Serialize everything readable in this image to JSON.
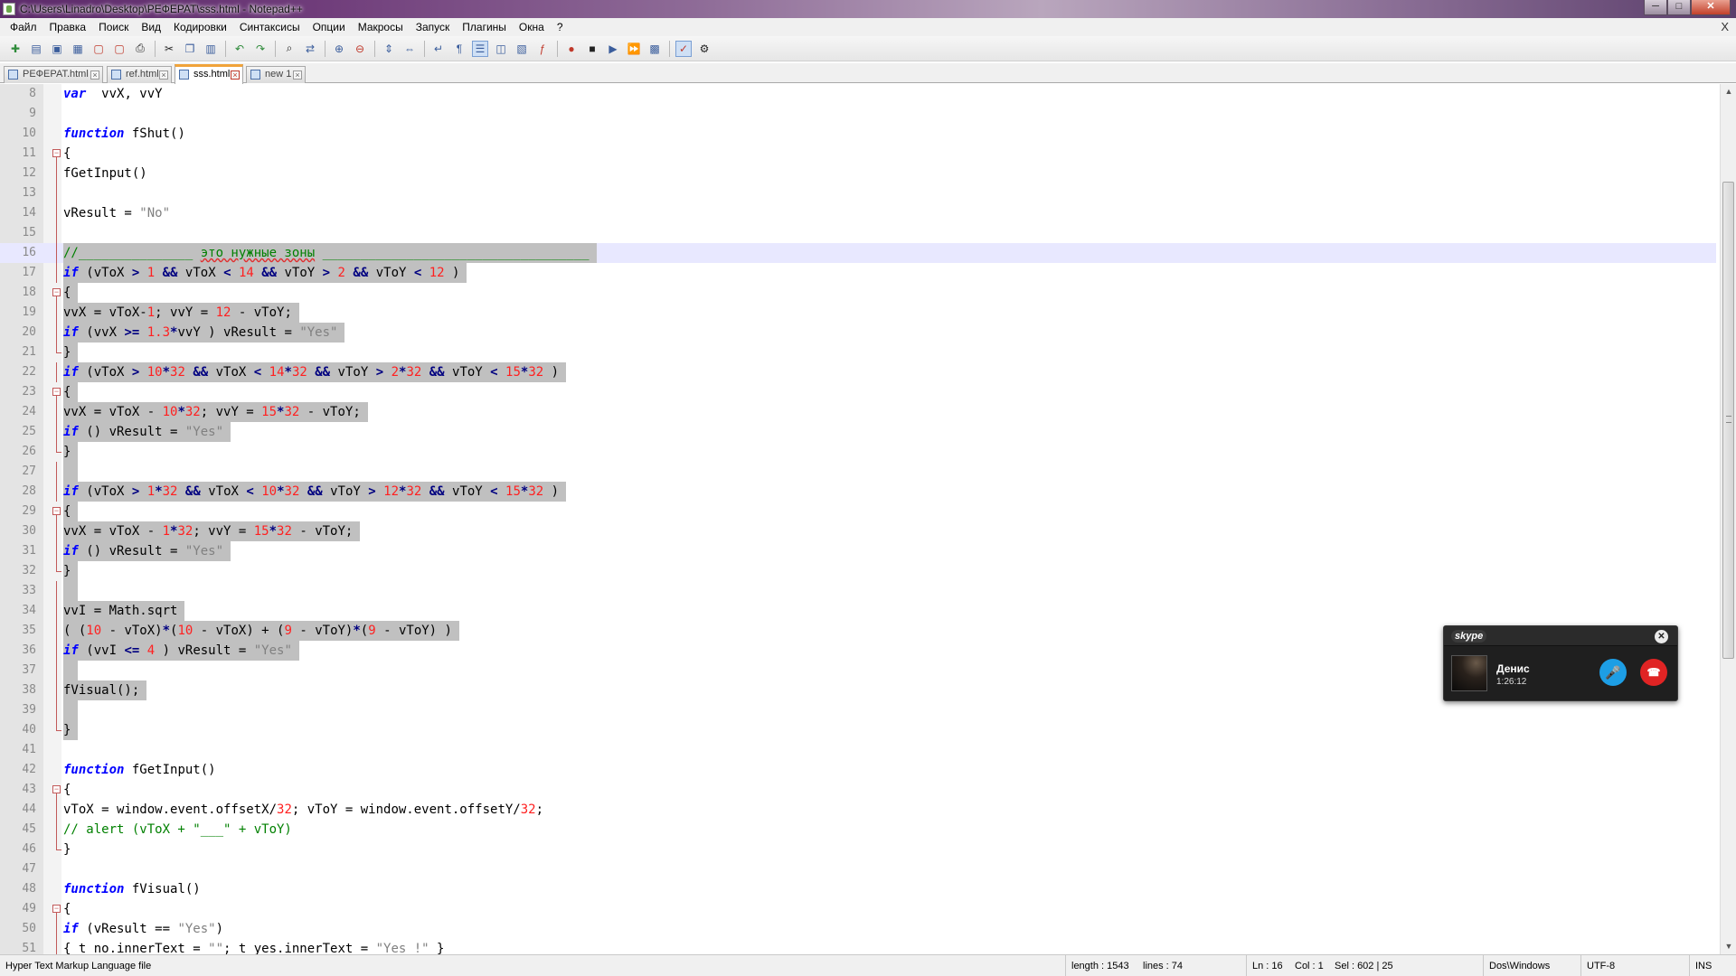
{
  "window": {
    "title": "C:\\Users\\Linadro\\Desktop\\РЕФЕРАТ\\sss.html - Notepad++",
    "minimize_glyph": "─",
    "maximize_glyph": "□",
    "close_glyph": "✕"
  },
  "menu": {
    "items": [
      "Файл",
      "Правка",
      "Поиск",
      "Вид",
      "Кодировки",
      "Синтаксисы",
      "Опции",
      "Макросы",
      "Запуск",
      "Плагины",
      "Окна",
      "?"
    ],
    "close_doc_glyph": "X"
  },
  "toolbar": {
    "icons": [
      "new-file-icon",
      "open-file-icon",
      "save-icon",
      "save-all-icon",
      "close-icon",
      "close-all-icon",
      "print-icon",
      "cut-icon",
      "copy-icon",
      "paste-icon",
      "undo-icon",
      "redo-icon",
      "find-icon",
      "replace-icon",
      "zoom-in-icon",
      "zoom-out-icon",
      "sync-vertical-icon",
      "sync-horizontal-icon",
      "word-wrap-icon",
      "show-all-chars-icon",
      "indent-guide-icon",
      "user-language-icon",
      "document-map-icon",
      "function-list-icon",
      "record-macro-icon",
      "stop-record-icon",
      "play-macro-icon",
      "run-macro-multiple-icon",
      "save-macro-icon",
      "spell-check-icon",
      "spell-settings-icon"
    ]
  },
  "tabs": [
    {
      "label": "РЕФЕРАТ.html",
      "active": false
    },
    {
      "label": "ref.html",
      "active": false
    },
    {
      "label": "sss.html",
      "active": true
    },
    {
      "label": "new  1",
      "active": false
    }
  ],
  "editor": {
    "colors": {
      "keyword": "#0000ff",
      "number": "#ff2020",
      "string": "#808080",
      "comment": "#008000",
      "selection": "#c0c0c0",
      "current_line": "#e8e8ff"
    },
    "lines": [
      {
        "n": "8",
        "fold": "",
        "sel": false,
        "tokens": [
          [
            "kw",
            "var"
          ],
          [
            "",
            "  vvX, vvY"
          ]
        ]
      },
      {
        "n": "9",
        "fold": "",
        "sel": false,
        "tokens": []
      },
      {
        "n": "10",
        "fold": "",
        "sel": false,
        "tokens": [
          [
            "kw",
            "function"
          ],
          [
            "",
            " fShut()"
          ]
        ]
      },
      {
        "n": "11",
        "fold": "box",
        "sel": false,
        "tokens": [
          [
            "",
            "{"
          ]
        ]
      },
      {
        "n": "12",
        "fold": "line",
        "sel": false,
        "tokens": [
          [
            "",
            "fGetInput()"
          ]
        ]
      },
      {
        "n": "13",
        "fold": "line",
        "sel": false,
        "tokens": []
      },
      {
        "n": "14",
        "fold": "line",
        "sel": false,
        "tokens": [
          [
            "",
            "vResult = "
          ],
          [
            "str",
            "\"No\""
          ]
        ]
      },
      {
        "n": "15",
        "fold": "line",
        "sel": false,
        "tokens": []
      },
      {
        "n": "16",
        "fold": "line",
        "sel": true,
        "current": true,
        "tokens": [
          [
            "cmt",
            "//_______________ "
          ],
          [
            "cmt squig",
            "это нужные зоны"
          ],
          [
            "cmt",
            " ___________________________________"
          ]
        ]
      },
      {
        "n": "17",
        "fold": "line",
        "sel": true,
        "tokens": [
          [
            "kw",
            "if"
          ],
          [
            "",
            " (vToX "
          ],
          [
            "op",
            ">"
          ],
          [
            "",
            " "
          ],
          [
            "num",
            "1"
          ],
          [
            "",
            " "
          ],
          [
            "op",
            "&&"
          ],
          [
            "",
            " vToX "
          ],
          [
            "op",
            "<"
          ],
          [
            "",
            " "
          ],
          [
            "num",
            "14"
          ],
          [
            "",
            " "
          ],
          [
            "op",
            "&&"
          ],
          [
            "",
            " vToY "
          ],
          [
            "op",
            ">"
          ],
          [
            "",
            " "
          ],
          [
            "num",
            "2"
          ],
          [
            "",
            " "
          ],
          [
            "op",
            "&&"
          ],
          [
            "",
            " vToY "
          ],
          [
            "op",
            "<"
          ],
          [
            "",
            " "
          ],
          [
            "num",
            "12"
          ],
          [
            "",
            " )"
          ]
        ]
      },
      {
        "n": "18",
        "fold": "box",
        "sel": true,
        "tokens": [
          [
            "",
            "{"
          ]
        ]
      },
      {
        "n": "19",
        "fold": "line",
        "sel": true,
        "tokens": [
          [
            "",
            "vvX = vToX-"
          ],
          [
            "num",
            "1"
          ],
          [
            "",
            "; vvY = "
          ],
          [
            "num",
            "12"
          ],
          [
            "",
            " - vToY;"
          ]
        ]
      },
      {
        "n": "20",
        "fold": "line",
        "sel": true,
        "tokens": [
          [
            "kw",
            "if"
          ],
          [
            "",
            " (vvX "
          ],
          [
            "op",
            ">="
          ],
          [
            "",
            " "
          ],
          [
            "num",
            "1.3"
          ],
          [
            "op",
            "*"
          ],
          [
            "",
            "vvY ) vResult = "
          ],
          [
            "str",
            "\"Yes\""
          ]
        ]
      },
      {
        "n": "21",
        "fold": "end",
        "sel": true,
        "tokens": [
          [
            "",
            "}"
          ]
        ]
      },
      {
        "n": "22",
        "fold": "line",
        "sel": true,
        "tokens": [
          [
            "kw",
            "if"
          ],
          [
            "",
            " (vToX "
          ],
          [
            "op",
            ">"
          ],
          [
            "",
            " "
          ],
          [
            "num",
            "10"
          ],
          [
            "op",
            "*"
          ],
          [
            "num",
            "32"
          ],
          [
            "",
            " "
          ],
          [
            "op",
            "&&"
          ],
          [
            "",
            " vToX "
          ],
          [
            "op",
            "<"
          ],
          [
            "",
            " "
          ],
          [
            "num",
            "14"
          ],
          [
            "op",
            "*"
          ],
          [
            "num",
            "32"
          ],
          [
            "",
            " "
          ],
          [
            "op",
            "&&"
          ],
          [
            "",
            " vToY "
          ],
          [
            "op",
            ">"
          ],
          [
            "",
            " "
          ],
          [
            "num",
            "2"
          ],
          [
            "op",
            "*"
          ],
          [
            "num",
            "32"
          ],
          [
            "",
            " "
          ],
          [
            "op",
            "&&"
          ],
          [
            "",
            " vToY "
          ],
          [
            "op",
            "<"
          ],
          [
            "",
            " "
          ],
          [
            "num",
            "15"
          ],
          [
            "op",
            "*"
          ],
          [
            "num",
            "32"
          ],
          [
            "",
            " )"
          ]
        ]
      },
      {
        "n": "23",
        "fold": "box",
        "sel": true,
        "tokens": [
          [
            "",
            "{"
          ]
        ]
      },
      {
        "n": "24",
        "fold": "line",
        "sel": true,
        "tokens": [
          [
            "",
            "vvX = vToX - "
          ],
          [
            "num",
            "10"
          ],
          [
            "op",
            "*"
          ],
          [
            "num",
            "32"
          ],
          [
            "",
            "; vvY = "
          ],
          [
            "num",
            "15"
          ],
          [
            "op",
            "*"
          ],
          [
            "num",
            "32"
          ],
          [
            "",
            " - vToY;"
          ]
        ]
      },
      {
        "n": "25",
        "fold": "line",
        "sel": true,
        "tokens": [
          [
            "kw",
            "if"
          ],
          [
            "",
            " () vResult = "
          ],
          [
            "str",
            "\"Yes\""
          ]
        ]
      },
      {
        "n": "26",
        "fold": "end",
        "sel": true,
        "tokens": [
          [
            "",
            "}"
          ]
        ]
      },
      {
        "n": "27",
        "fold": "line",
        "sel": true,
        "tokens": []
      },
      {
        "n": "28",
        "fold": "line",
        "sel": true,
        "tokens": [
          [
            "kw",
            "if"
          ],
          [
            "",
            " (vToX "
          ],
          [
            "op",
            ">"
          ],
          [
            "",
            " "
          ],
          [
            "num",
            "1"
          ],
          [
            "op",
            "*"
          ],
          [
            "num",
            "32"
          ],
          [
            "",
            " "
          ],
          [
            "op",
            "&&"
          ],
          [
            "",
            " vToX "
          ],
          [
            "op",
            "<"
          ],
          [
            "",
            " "
          ],
          [
            "num",
            "10"
          ],
          [
            "op",
            "*"
          ],
          [
            "num",
            "32"
          ],
          [
            "",
            " "
          ],
          [
            "op",
            "&&"
          ],
          [
            "",
            " vToY "
          ],
          [
            "op",
            ">"
          ],
          [
            "",
            " "
          ],
          [
            "num",
            "12"
          ],
          [
            "op",
            "*"
          ],
          [
            "num",
            "32"
          ],
          [
            "",
            " "
          ],
          [
            "op",
            "&&"
          ],
          [
            "",
            " vToY "
          ],
          [
            "op",
            "<"
          ],
          [
            "",
            " "
          ],
          [
            "num",
            "15"
          ],
          [
            "op",
            "*"
          ],
          [
            "num",
            "32"
          ],
          [
            "",
            " )"
          ]
        ]
      },
      {
        "n": "29",
        "fold": "box",
        "sel": true,
        "tokens": [
          [
            "",
            "{"
          ]
        ]
      },
      {
        "n": "30",
        "fold": "line",
        "sel": true,
        "tokens": [
          [
            "",
            "vvX = vToX - "
          ],
          [
            "num",
            "1"
          ],
          [
            "op",
            "*"
          ],
          [
            "num",
            "32"
          ],
          [
            "",
            "; vvY = "
          ],
          [
            "num",
            "15"
          ],
          [
            "op",
            "*"
          ],
          [
            "num",
            "32"
          ],
          [
            "",
            " - vToY;"
          ]
        ]
      },
      {
        "n": "31",
        "fold": "line",
        "sel": true,
        "tokens": [
          [
            "kw",
            "if"
          ],
          [
            "",
            " () vResult = "
          ],
          [
            "str",
            "\"Yes\""
          ]
        ]
      },
      {
        "n": "32",
        "fold": "end",
        "sel": true,
        "tokens": [
          [
            "",
            "}"
          ]
        ]
      },
      {
        "n": "33",
        "fold": "line",
        "sel": true,
        "tokens": []
      },
      {
        "n": "34",
        "fold": "line",
        "sel": true,
        "tokens": [
          [
            "",
            "vvI = Math.sqrt"
          ]
        ]
      },
      {
        "n": "35",
        "fold": "line",
        "sel": true,
        "tokens": [
          [
            "",
            "( ("
          ],
          [
            "num",
            "10"
          ],
          [
            "",
            " - vToX)"
          ],
          [
            "op",
            "*"
          ],
          [
            "",
            "("
          ],
          [
            "num",
            "10"
          ],
          [
            "",
            " - vToX) + ("
          ],
          [
            "num",
            "9"
          ],
          [
            "",
            " - vToY)"
          ],
          [
            "op",
            "*"
          ],
          [
            "",
            "("
          ],
          [
            "num",
            "9"
          ],
          [
            "",
            " - vToY) )"
          ]
        ]
      },
      {
        "n": "36",
        "fold": "line",
        "sel": true,
        "tokens": [
          [
            "kw",
            "if"
          ],
          [
            "",
            " (vvI "
          ],
          [
            "op",
            "<="
          ],
          [
            "",
            " "
          ],
          [
            "num",
            "4"
          ],
          [
            "",
            " ) vResult = "
          ],
          [
            "str",
            "\"Yes\""
          ]
        ]
      },
      {
        "n": "37",
        "fold": "line",
        "sel": true,
        "tokens": []
      },
      {
        "n": "38",
        "fold": "line",
        "sel": true,
        "tokens": [
          [
            "",
            "fVisual();"
          ]
        ]
      },
      {
        "n": "39",
        "fold": "line",
        "sel": true,
        "tokens": []
      },
      {
        "n": "40",
        "fold": "end",
        "sel": true,
        "tokens": [
          [
            "",
            "}"
          ]
        ]
      },
      {
        "n": "41",
        "fold": "",
        "sel": false,
        "tokens": []
      },
      {
        "n": "42",
        "fold": "",
        "sel": false,
        "tokens": [
          [
            "kw",
            "function"
          ],
          [
            "",
            " fGetInput()"
          ]
        ]
      },
      {
        "n": "43",
        "fold": "box",
        "sel": false,
        "tokens": [
          [
            "",
            "{"
          ]
        ]
      },
      {
        "n": "44",
        "fold": "line",
        "sel": false,
        "tokens": [
          [
            "",
            "vToX = window.event.offsetX/"
          ],
          [
            "num",
            "32"
          ],
          [
            "",
            "; vToY = window.event.offsetY/"
          ],
          [
            "num",
            "32"
          ],
          [
            ";",
            ";"
          ]
        ]
      },
      {
        "n": "45",
        "fold": "line",
        "sel": false,
        "tokens": [
          [
            "cmt",
            "// alert (vToX + \"___\" + vToY)"
          ]
        ]
      },
      {
        "n": "46",
        "fold": "end",
        "sel": false,
        "tokens": [
          [
            "",
            "}"
          ]
        ]
      },
      {
        "n": "47",
        "fold": "",
        "sel": false,
        "tokens": []
      },
      {
        "n": "48",
        "fold": "",
        "sel": false,
        "tokens": [
          [
            "kw",
            "function"
          ],
          [
            "",
            " fVisual()"
          ]
        ]
      },
      {
        "n": "49",
        "fold": "box",
        "sel": false,
        "tokens": [
          [
            "",
            "{"
          ]
        ]
      },
      {
        "n": "50",
        "fold": "line",
        "sel": false,
        "tokens": [
          [
            "kw",
            "if"
          ],
          [
            "",
            " (vResult == "
          ],
          [
            "str",
            "\"Yes\""
          ],
          [
            "",
            ")"
          ]
        ]
      },
      {
        "n": "51",
        "fold": "line",
        "sel": false,
        "tokens": [
          [
            "",
            "{ t_no.innerText = "
          ],
          [
            "str",
            "\"\""
          ],
          [
            "",
            "; t_yes.innerText = "
          ],
          [
            "str",
            "\"Yes !\""
          ],
          [
            "",
            " }"
          ]
        ]
      }
    ]
  },
  "statusbar": {
    "file_type": "Hyper Text Markup Language file",
    "length": "length : 1543",
    "lines": "lines : 74",
    "ln": "Ln : 16",
    "col": "Col : 1",
    "sel": "Sel : 602 | 25",
    "eol": "Dos\\Windows",
    "encoding": "UTF-8",
    "mode": "INS"
  },
  "skype": {
    "logo": "skype",
    "contact_name": "Денис",
    "call_duration": "1:26:12",
    "close_glyph": "✕",
    "mic_glyph": "🎤",
    "hangup_glyph": "☎"
  }
}
